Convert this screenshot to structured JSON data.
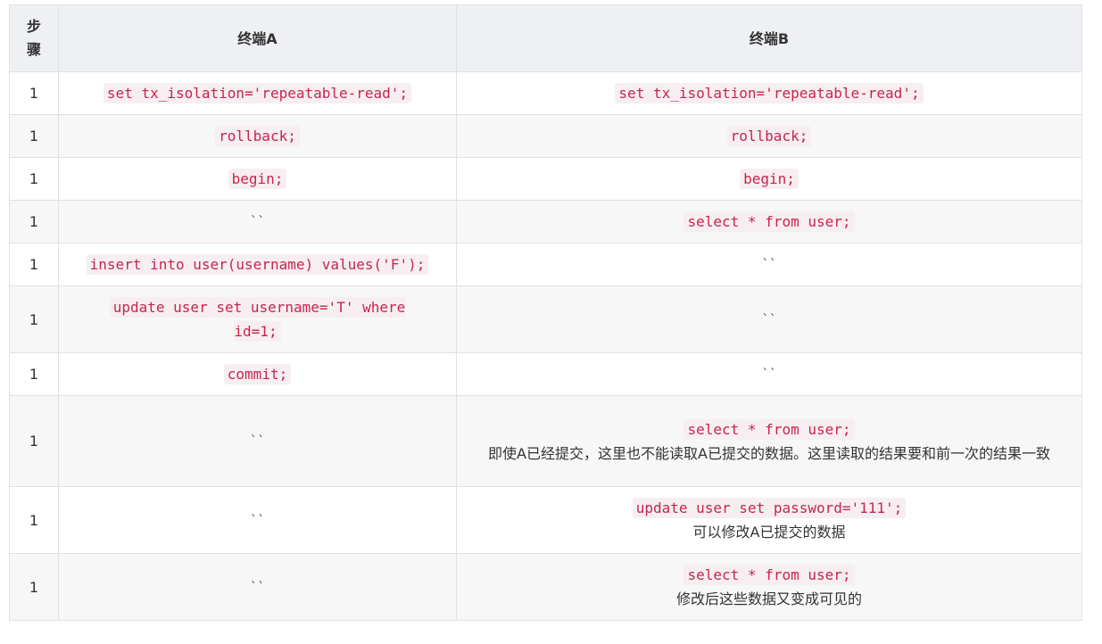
{
  "header": {
    "step": "步骤",
    "a": "终端A",
    "b": "终端B"
  },
  "rows": [
    {
      "step": "1",
      "a": "set tx_isolation='repeatable-read';",
      "b": "set tx_isolation='repeatable-read';",
      "b_note": ""
    },
    {
      "step": "1",
      "a": "rollback;",
      "b": "rollback;",
      "b_note": ""
    },
    {
      "step": "1",
      "a": "begin;",
      "b": "begin;",
      "b_note": ""
    },
    {
      "step": "1",
      "a": "``",
      "b": "select * from user;",
      "b_note": ""
    },
    {
      "step": "1",
      "a": "insert into user(username) values('F');",
      "b": "``",
      "b_note": ""
    },
    {
      "step": "1",
      "a": "update user set username='T' where id=1;",
      "b": "``",
      "b_note": ""
    },
    {
      "step": "1",
      "a": "commit;",
      "b": "``",
      "b_note": ""
    },
    {
      "step": "1",
      "a": "``",
      "b": "select * from user;",
      "b_note": "即使A已经提交，这里也不能读取A已提交的数据。这里读取的结果要和前一次的结果一致"
    },
    {
      "step": "1",
      "a": "``",
      "b": "update user set password='111';",
      "b_note": "可以修改A已提交的数据"
    },
    {
      "step": "1",
      "a": "``",
      "b": "select * from user;",
      "b_note": "修改后这些数据又变成可见的"
    }
  ]
}
